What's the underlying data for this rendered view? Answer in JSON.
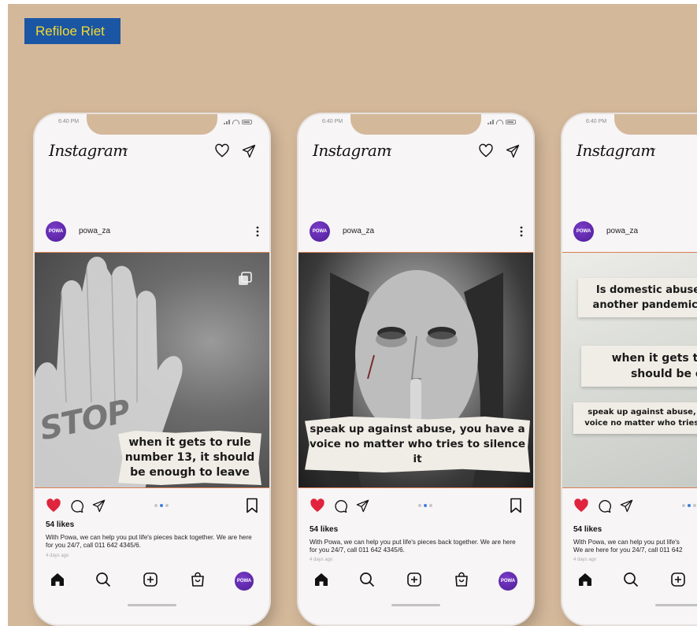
{
  "author": {
    "name": "Refiloe Riet"
  },
  "colors": {
    "background": "#d4b89a",
    "badge_bg": "#1b56a4",
    "badge_text": "#f5d931",
    "like_red": "#e0243d",
    "avatar_purple": "#5a22a8",
    "image_border": "#d97e52"
  },
  "phones": [
    {
      "status_time": "6:40 PM",
      "app_name": "Instagram",
      "username": "powa_za",
      "avatar_text": "POWA",
      "image_text": "STOP",
      "note": "when it gets to rule number 13, it should be enough to leave",
      "likes": "54 likes",
      "caption": "With Powa, we can help you put life's pieces back together. We are here for you 24/7, call 011 642 4345/6.",
      "posted_ago": "4 days ago"
    },
    {
      "status_time": "6:40 PM",
      "app_name": "Instagram",
      "username": "powa_za",
      "avatar_text": "POWA",
      "note": "speak up against abuse, you have a voice no matter who tries to silence it",
      "likes": "54 likes",
      "caption": "With Powa, we can help you put life's pieces back together. We are here for you 24/7, call 011 642 4345/6.",
      "posted_ago": "4 days ago"
    },
    {
      "status_time": "6:40 PM",
      "app_name": "Instagram",
      "username": "powa_za",
      "avatar_text": "POWA",
      "note_a": "Is domestic abuse another pandemic?",
      "note_b": "when it gets to rule\nshould be enoug",
      "note_c": "speak up against abuse, you\nvoice no matter who tries to s",
      "likes": "54 likes",
      "caption": "With Powa, we can help you put life's\nWe are here for you 24/7, call 011 642",
      "posted_ago": "4 days ago"
    }
  ]
}
